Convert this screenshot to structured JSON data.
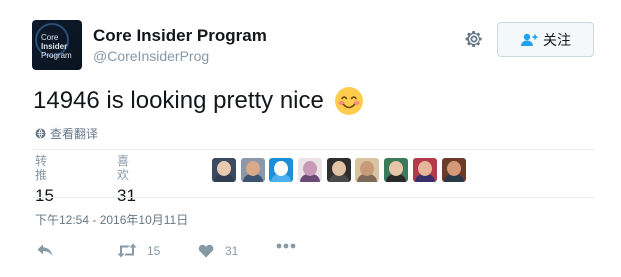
{
  "user": {
    "display_name": "Core Insider Program",
    "handle": "@CoreInsiderProg",
    "avatar_lines": [
      "Core",
      "Insider",
      "Program"
    ]
  },
  "follow_button": {
    "label": "关注",
    "icon": "add-user-icon"
  },
  "settings_icon": "gear-icon",
  "tweet": {
    "text": "14946 is looking pretty nice",
    "emoji": "smiling-face-icon"
  },
  "translate_label": "查看翻译",
  "stats": {
    "retweets": {
      "label": "转推",
      "value": "15"
    },
    "likes": {
      "label": "喜欢",
      "value": "31"
    }
  },
  "likers": [
    {
      "name": "liker-1"
    },
    {
      "name": "liker-2"
    },
    {
      "name": "liker-3"
    },
    {
      "name": "liker-4"
    },
    {
      "name": "liker-5"
    },
    {
      "name": "liker-6"
    },
    {
      "name": "liker-7"
    },
    {
      "name": "liker-8"
    },
    {
      "name": "liker-9"
    }
  ],
  "timestamp": "下午12:54 - 2016年10月11日",
  "actions": {
    "reply": {
      "icon": "reply-icon"
    },
    "retweet": {
      "icon": "retweet-icon",
      "count": "15"
    },
    "like": {
      "icon": "heart-icon",
      "count": "31"
    },
    "more": {
      "icon": "more-icon"
    }
  },
  "colors": {
    "text": "#14171a",
    "secondary": "#8899a6",
    "border": "#e6ecf0",
    "avatar_bg": "#0d1a2a"
  }
}
